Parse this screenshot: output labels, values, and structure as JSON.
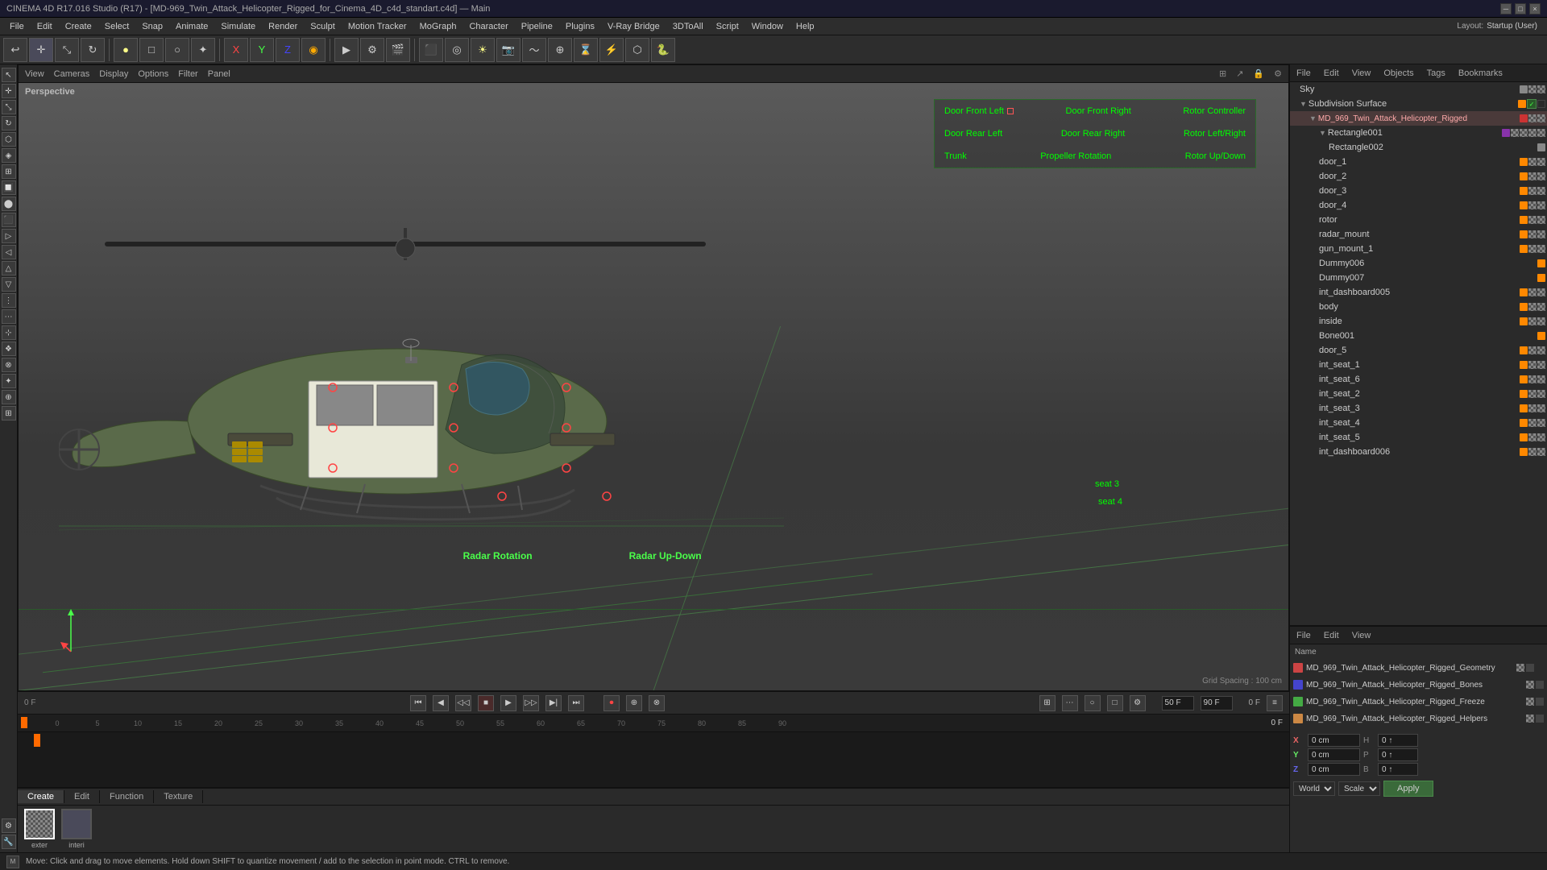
{
  "titlebar": {
    "title": "CINEMA 4D R17.016 Studio (R17) - [MD-969_Twin_Attack_Helicopter_Rigged_for_Cinema_4D_c4d_standart.c4d] — Main",
    "buttons": [
      "minimize",
      "maximize",
      "close"
    ]
  },
  "menubar": {
    "items": [
      "File",
      "Edit",
      "Create",
      "Select",
      "Snap",
      "Animate",
      "Simulate",
      "Render",
      "Sculpt",
      "Motion Tracker",
      "MoGraph",
      "Character",
      "Pipeline",
      "Plugins",
      "V-Ray Bridge",
      "3DToAll",
      "Script",
      "Window",
      "Help"
    ]
  },
  "toolbar": {
    "layout_label": "Layout:",
    "layout_value": "Startup (User)"
  },
  "viewport": {
    "header_items": [
      "View",
      "Cameras",
      "Display",
      "Options",
      "Filter",
      "Panel"
    ],
    "perspective_label": "Perspective",
    "grid_spacing": "Grid Spacing : 100 cm"
  },
  "annotations": {
    "rows": [
      [
        "Door Front Left",
        "Door Front Right",
        "Rotor Controller"
      ],
      [
        "Door Rear Left",
        "Door Rear Right",
        "Rotor Left/Right"
      ],
      [
        "Trunk",
        "Propeller Rotation",
        "Rotor Up/Down"
      ]
    ],
    "radar_labels": [
      "Radar Rotation",
      "Radar Up-Down"
    ]
  },
  "object_manager": {
    "header_tabs": [
      "File",
      "Edit",
      "View",
      "Objects",
      "Tags",
      "Bookmarks"
    ],
    "objects": [
      {
        "name": "Sky",
        "level": 0,
        "has_arrow": false,
        "color": "gray"
      },
      {
        "name": "Subdivision Surface",
        "level": 0,
        "has_arrow": true,
        "color": "orange",
        "checked": true
      },
      {
        "name": "MD_969_Twin_Attack_Helicopter_Rigged",
        "level": 1,
        "has_arrow": true,
        "color": "red"
      },
      {
        "name": "Rectangle001",
        "level": 2,
        "has_arrow": true,
        "color": "purple"
      },
      {
        "name": "Rectangle002",
        "level": 3,
        "has_arrow": false,
        "color": "gray"
      },
      {
        "name": "door_1",
        "level": 2,
        "has_arrow": false,
        "color": "orange"
      },
      {
        "name": "door_2",
        "level": 2,
        "has_arrow": false,
        "color": "orange"
      },
      {
        "name": "door_3",
        "level": 2,
        "has_arrow": false,
        "color": "orange"
      },
      {
        "name": "door_4",
        "level": 2,
        "has_arrow": false,
        "color": "orange"
      },
      {
        "name": "rotor",
        "level": 2,
        "has_arrow": false,
        "color": "orange"
      },
      {
        "name": "radar_mount",
        "level": 2,
        "has_arrow": false,
        "color": "orange"
      },
      {
        "name": "gun_mount_1",
        "level": 2,
        "has_arrow": false,
        "color": "orange"
      },
      {
        "name": "Dummy006",
        "level": 2,
        "has_arrow": false,
        "color": "orange"
      },
      {
        "name": "Dummy007",
        "level": 2,
        "has_arrow": false,
        "color": "orange"
      },
      {
        "name": "int_dashboard005",
        "level": 2,
        "has_arrow": false,
        "color": "orange"
      },
      {
        "name": "body",
        "level": 2,
        "has_arrow": false,
        "color": "orange"
      },
      {
        "name": "inside",
        "level": 2,
        "has_arrow": false,
        "color": "orange"
      },
      {
        "name": "Bone001",
        "level": 2,
        "has_arrow": false,
        "color": "orange"
      },
      {
        "name": "door_5",
        "level": 2,
        "has_arrow": false,
        "color": "orange"
      },
      {
        "name": "int_seat_1",
        "level": 2,
        "has_arrow": false,
        "color": "orange"
      },
      {
        "name": "int_seat_6",
        "level": 2,
        "has_arrow": false,
        "color": "orange"
      },
      {
        "name": "int_seat_2",
        "level": 2,
        "has_arrow": false,
        "color": "orange"
      },
      {
        "name": "int_seat_3",
        "level": 2,
        "has_arrow": false,
        "color": "orange"
      },
      {
        "name": "int_seat_4",
        "level": 2,
        "has_arrow": false,
        "color": "orange"
      },
      {
        "name": "int_seat_5",
        "level": 2,
        "has_arrow": false,
        "color": "orange"
      },
      {
        "name": "int_dashboard006",
        "level": 2,
        "has_arrow": false,
        "color": "orange"
      }
    ]
  },
  "seat3_label": "seat 3",
  "seat4_label": "seat 4",
  "attribute_manager": {
    "header_tabs": [
      "File",
      "Edit",
      "View"
    ],
    "objects_label": "Name",
    "files": [
      {
        "name": "MD_969_Twin_Attack_Helicopter_Rigged_Geometry",
        "color": "#cc4444"
      },
      {
        "name": "MD_969_Twin_Attack_Helicopter_Rigged_Bones",
        "color": "#4444cc"
      },
      {
        "name": "MD_969_Twin_Attack_Helicopter_Rigged_Freeze",
        "color": "#44aa44"
      },
      {
        "name": "MD_969_Twin_Attack_Helicopter_Rigged_Helpers",
        "color": "#cc8844"
      }
    ],
    "coords": {
      "X": {
        "pos": "0 cm",
        "size": "0 cm"
      },
      "Y": {
        "pos": "0 cm",
        "size": "0 cm"
      },
      "Z": {
        "pos": "0 cm",
        "size": "0 cm"
      },
      "H": "0 ↑",
      "P": "0 ↑",
      "B": "0 ↑"
    },
    "coord_mode": "World",
    "scale_label": "Scale",
    "apply_label": "Apply"
  },
  "timeline": {
    "current_frame": "0 F",
    "end_frame": "0 F",
    "fps": "50 F",
    "fps2": "90 F",
    "markers": [
      0,
      5,
      10,
      15,
      20,
      25,
      30,
      35,
      40,
      45,
      50,
      55,
      60,
      65,
      70,
      75,
      80,
      85,
      90
    ]
  },
  "material_panel": {
    "tabs": [
      "Create",
      "Edit",
      "Function",
      "Texture"
    ],
    "materials": [
      {
        "name": "exter",
        "color": "#5a6a5a"
      },
      {
        "name": "interi",
        "color": "#4a4a5a"
      }
    ]
  },
  "status_bar": {
    "message": "Move: Click and drag to move elements. Hold down SHIFT to quantize movement / add to the selection in point mode. CTRL to remove."
  }
}
